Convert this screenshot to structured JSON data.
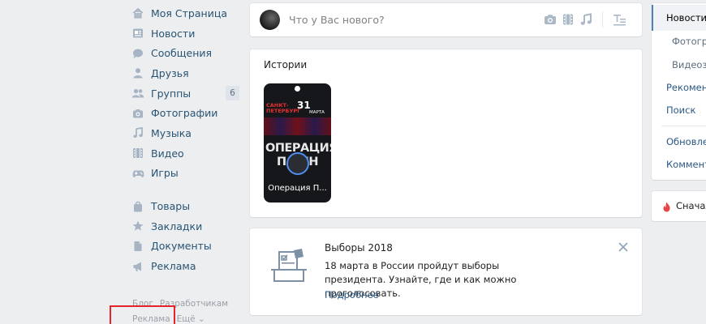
{
  "left_nav": {
    "items": [
      {
        "label": "Моя Страница",
        "icon": "home-icon"
      },
      {
        "label": "Новости",
        "icon": "news-icon"
      },
      {
        "label": "Сообщения",
        "icon": "messages-icon"
      },
      {
        "label": "Друзья",
        "icon": "friend-icon"
      },
      {
        "label": "Группы",
        "icon": "groups-icon",
        "badge": "6"
      },
      {
        "label": "Фотографии",
        "icon": "camera-icon"
      },
      {
        "label": "Музыка",
        "icon": "music-icon"
      },
      {
        "label": "Видео",
        "icon": "video-icon"
      },
      {
        "label": "Игры",
        "icon": "gamepad-icon"
      }
    ],
    "items2": [
      {
        "label": "Товары",
        "icon": "bag-icon"
      },
      {
        "label": "Закладки",
        "icon": "star-icon"
      },
      {
        "label": "Документы",
        "icon": "document-icon"
      },
      {
        "label": "Реклама",
        "icon": "ads-icon"
      }
    ],
    "footer": {
      "blog": "Блог",
      "developers": "Разработчикам",
      "ads": "Реклама",
      "more": "Ещё ⌄"
    }
  },
  "post_box": {
    "placeholder": "Что у Вас нового?"
  },
  "stories": {
    "title": "Истории",
    "items": [
      {
        "caption": "Операция П...",
        "poster": {
          "city": "САНКТ-\nПЕТЕРБУРГ",
          "date": "31",
          "month": "МАРТА",
          "title": "ОПЕРАЦИЯ\nПЛ   ИН"
        }
      }
    ]
  },
  "election": {
    "title": "Выборы 2018",
    "text": "18 марта в России пройдут выборы президента. Узнайте, где и как можно проголосовать.",
    "link": "Подробнее"
  },
  "right_menu": {
    "active": "Новости",
    "items": [
      "Фотогр",
      "Видеоза",
      "Рекомен",
      "Поиск",
      "Обновле",
      "Коммент"
    ]
  },
  "right_sort": {
    "label": "Сначала"
  },
  "colors": {
    "background": "#edeef0",
    "link": "#2a5885",
    "nav_text": "#285473",
    "highlight_box": "#e5242a",
    "accent": "#5181b8"
  }
}
